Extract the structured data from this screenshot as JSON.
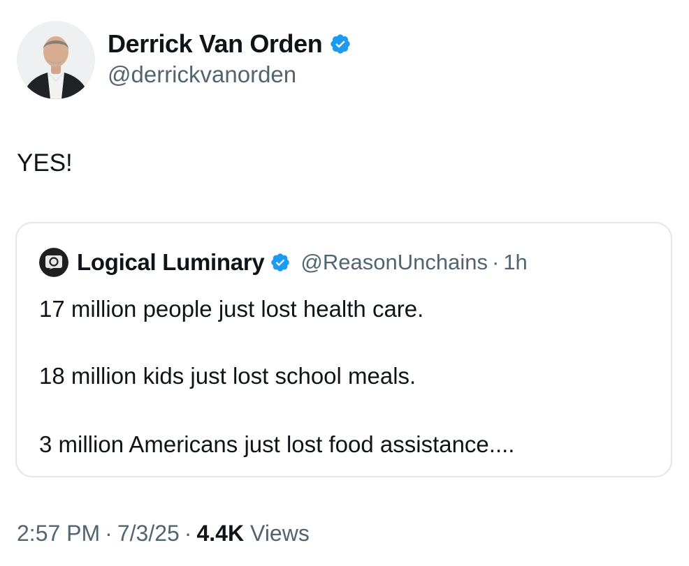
{
  "author": {
    "name": "Derrick Van Orden",
    "handle": "@derrickvanorden",
    "verified": true,
    "avatar_icon": "profile-photo",
    "verified_icon": "verified-badge-icon",
    "verified_color": "#1d9bf0"
  },
  "tweet": {
    "text": "YES!"
  },
  "quote": {
    "name": "Logical Luminary",
    "handle": "@ReasonUnchains",
    "separator": "·",
    "time": "1h",
    "verified": true,
    "avatar_icon": "quote-avatar",
    "lines": [
      "17 million people just lost health care.",
      "18 million kids just lost school meals.",
      "3 million Americans just lost food assistance...."
    ]
  },
  "meta": {
    "time": "2:57 PM",
    "separator": "·",
    "date": "7/3/25",
    "views_count": "4.4K",
    "views_label": "Views"
  },
  "colors": {
    "text_primary": "#0f1419",
    "text_secondary": "#536471",
    "border": "#e3e7ea"
  }
}
